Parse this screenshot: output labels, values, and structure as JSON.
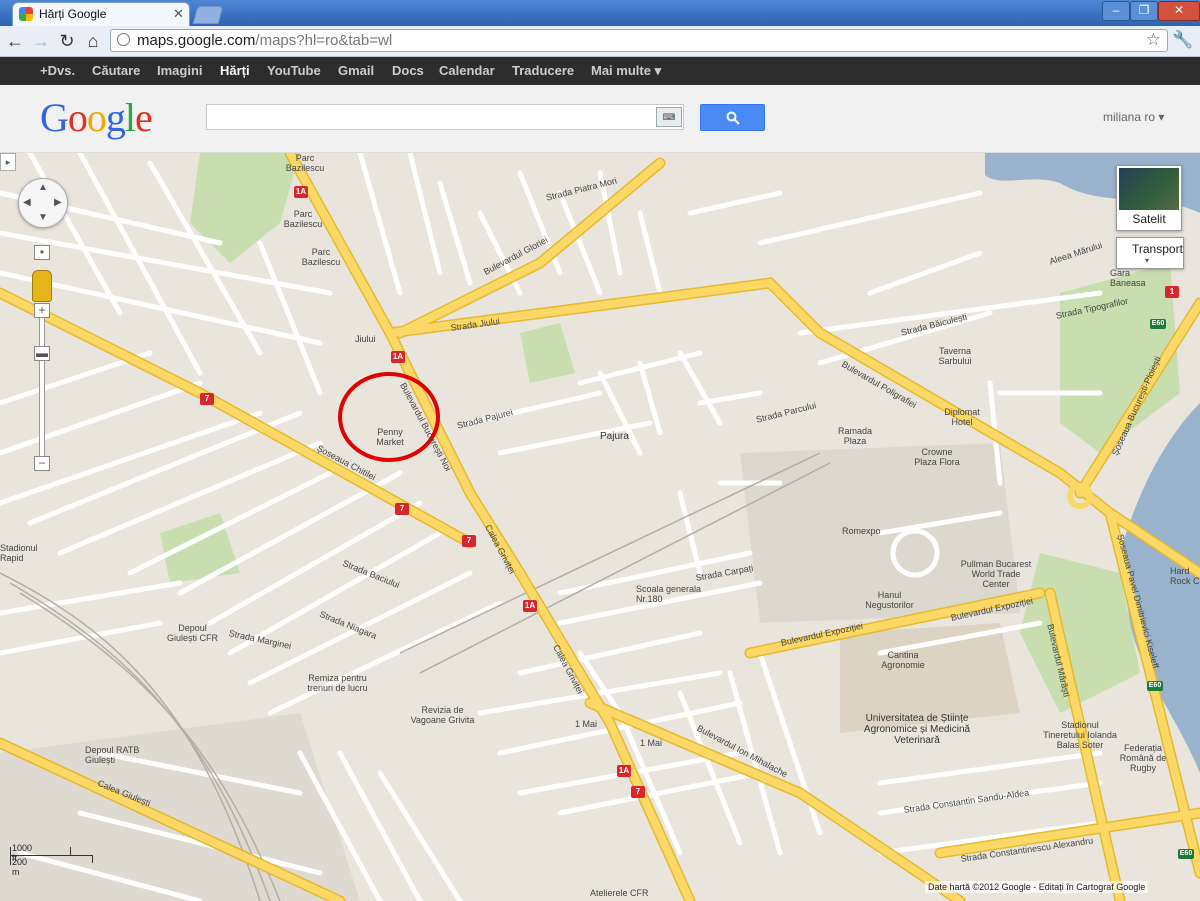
{
  "browser": {
    "tab_title": "Hărți Google",
    "url_host": "maps.google.com",
    "url_path": "/maps?hl=ro&tab=wl",
    "window_buttons": [
      "‒",
      "❐",
      "✕"
    ]
  },
  "gbar": {
    "items": [
      "+Dvs.",
      "Căutare",
      "Imagini",
      "Hărți",
      "YouTube",
      "Gmail",
      "Docs",
      "Calendar",
      "Traducere",
      "Mai multe ▾"
    ],
    "active": "Hărți"
  },
  "header": {
    "logo": [
      "G",
      "o",
      "o",
      "g",
      "l",
      "e"
    ],
    "search_value": "",
    "keyboard_icon": "⌨",
    "search_button_icon": "🔍",
    "user": "miliana ro ▾"
  },
  "map_controls": {
    "pan_arrows": [
      "▲",
      "▼",
      "◀",
      "▶"
    ],
    "zoom_in": "+",
    "zoom_out": "−",
    "satellite_label": "Satelit",
    "transport_label": "Transport",
    "scale_ft": "1000 ft",
    "scale_m": "200 m",
    "attribution": "Date hartă ©2012 Google -  Editați în Cartograf Google"
  },
  "map_labels": {
    "parc1": "Parc Bazilescu",
    "parc2": "Parc Bazilescu",
    "parc3": "Parc Bazilescu",
    "jiului": "Jiului",
    "penny": "Penny Market",
    "pajura": "Pajura",
    "romexpo": "Romexpo",
    "ramada": "Ramada Plaza",
    "crowne": "Crowne Plaza Flora",
    "diplomat": "Diplomat Hotel",
    "taverna": "Taverna Sarbului",
    "pullman": "Pullman Bucarest World Trade Center",
    "hanul": "Hanul Negustorilor",
    "scoala": "Scoala generala Nr.180",
    "cantina": "Cantina Agronomie",
    "usamv": "Universitatea de Științe Agronomice și Medicină Veterinară",
    "stadionul": "Stadionul Tineretului Iolanda Balas Soter",
    "federatia": "Federația Română de Rugby",
    "depoul_giulesti": "Depoul Giulești CFR",
    "depoul_ratb": "Depoul RATB Giulești",
    "remiza": "Remiza pentru trenuri de lucru",
    "revizia": "Revizia de Vagoane Grivita",
    "ateliere": "Atelierele CFR",
    "unumai1": "1 Mai",
    "unumai2": "1 Mai",
    "gara": "Gara Baneasa",
    "stadion": "Stadionul Rapid",
    "hard_rock": "Hard Rock C",
    "aleea": "Aleea Mărului",
    "bd_bucuresti_noi": "Bulevardul București Noi",
    "calea_grivitei": "Calea Griviței",
    "calea_grivitei2": "Calea Griviței",
    "sos_chitilei": "Șoseaua Chitilei",
    "str_jiului": "Strada Jiului",
    "bd_poligrafiei": "Bulevardul Poligrafiei",
    "bd_expozitiei": "Bulevardul Expoziției",
    "bd_expozitiei2": "Bulevardul Expoziției",
    "bd_ion_mihalache": "Bulevardul Ion Mihalache",
    "bd_marasti": "Bulevardul Mărăști",
    "sos_kiseleff": "Șoseaua Pavel Dimitrievici Kiseleff",
    "sos_bucuresti_ploiesti": "Șoseaua București-Ploiești",
    "calea_giulesti": "Calea Giulești",
    "bd_gloriei": "Bulevardul Gloriei",
    "str_piatra_mori": "Strada Piatra Mori",
    "str_parcului": "Strada Parcului",
    "str_pajurei": "Strada Pajurei",
    "str_carpati": "Strada Carpați",
    "str_marginei": "Strada Marginei",
    "str_niagara": "Strada Niagara",
    "str_baciului": "Strada Baciului",
    "str_teiul": "Strada Constantin Sandu-Aldea",
    "str_sanatescu": "Strada Constantinescu Alexandru",
    "str_tipografilor": "Strada Tipografilor",
    "str_baiculesti": "Strada Băiculești"
  },
  "route_shields": [
    "1A",
    "1A",
    "1A",
    "1A",
    "7",
    "7",
    "7",
    "7",
    "1",
    "E60",
    "E60",
    "E60"
  ],
  "colors": {
    "map_bg": "#e9e5dc",
    "major_road": "#fcd966",
    "major_road_edge": "#e6b82f",
    "minor_road": "#ffffff",
    "park": "#c8deaf",
    "water": "#99b3cc",
    "marker_circle": "#e00000"
  }
}
